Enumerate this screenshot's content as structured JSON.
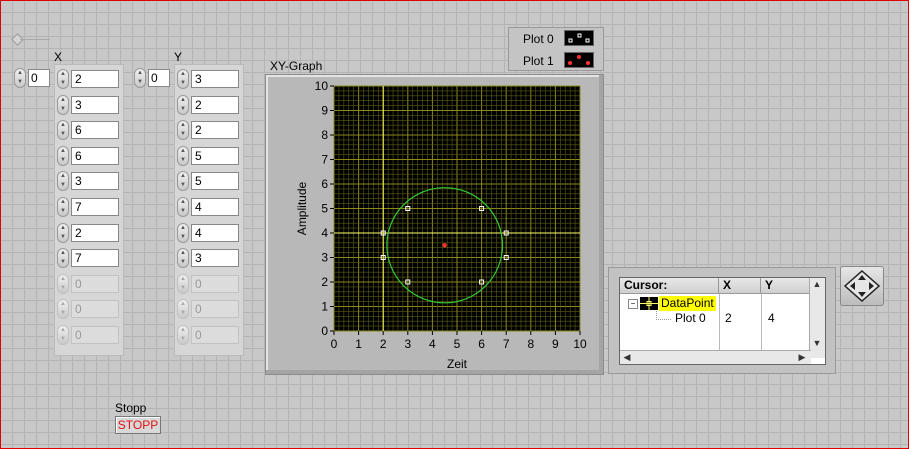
{
  "array_x": {
    "label": "X",
    "index": "0",
    "values": [
      "2",
      "3",
      "6",
      "6",
      "3",
      "7",
      "2",
      "7",
      "0",
      "0",
      "0"
    ],
    "enabled": [
      true,
      true,
      true,
      true,
      true,
      true,
      true,
      true,
      false,
      false,
      false
    ]
  },
  "array_y": {
    "label": "Y",
    "index": "0",
    "values": [
      "3",
      "2",
      "2",
      "5",
      "5",
      "4",
      "4",
      "3",
      "0",
      "0",
      "0"
    ],
    "enabled": [
      true,
      true,
      true,
      true,
      true,
      true,
      true,
      true,
      false,
      false,
      false
    ]
  },
  "graph": {
    "title": "XY-Graph",
    "xlabel": "Zeit",
    "ylabel": "Amplitude",
    "plot_background": "#000000",
    "grid_color": "#5c5c14",
    "cursor_color": "#ffff66"
  },
  "legend": {
    "items": [
      {
        "label": "Plot 0",
        "icon": "white-square-markers-icon"
      },
      {
        "label": "Plot 1",
        "icon": "red-dot-markers-icon"
      }
    ]
  },
  "chart_data": {
    "type": "scatter",
    "title": "XY-Graph",
    "xlabel": "Zeit",
    "ylabel": "Amplitude",
    "xlim": [
      0,
      10
    ],
    "ylim": [
      0,
      10
    ],
    "xticks": [
      "0",
      "1",
      "2",
      "3",
      "4",
      "5",
      "6",
      "7",
      "8",
      "9",
      "10"
    ],
    "yticks": [
      "0",
      "1",
      "2",
      "3",
      "4",
      "5",
      "6",
      "7",
      "8",
      "9",
      "10"
    ],
    "grid": true,
    "series": [
      {
        "name": "Plot 0",
        "color": "#ffffff",
        "marker": "square",
        "x": [
          2,
          3,
          6,
          6,
          3,
          7,
          2,
          7
        ],
        "y": [
          3,
          2,
          2,
          5,
          5,
          4,
          4,
          3
        ]
      },
      {
        "name": "Plot 1",
        "color": "#ff3030",
        "marker": "dot",
        "x": [
          4.5
        ],
        "y": [
          3.5
        ]
      }
    ],
    "circle": {
      "center": [
        4.5,
        3.5
      ],
      "radius": 2.35,
      "color": "#33cc33"
    },
    "cursor": {
      "x": 2,
      "y": 4,
      "color": "#ffff66"
    }
  },
  "cursor_panel": {
    "headers": [
      "Cursor:",
      "X",
      "Y"
    ],
    "cursor_name": "DataPoint",
    "plot": "Plot 0",
    "x": "2",
    "y": "4"
  },
  "stop": {
    "label": "Stopp",
    "button": "STOPP"
  }
}
